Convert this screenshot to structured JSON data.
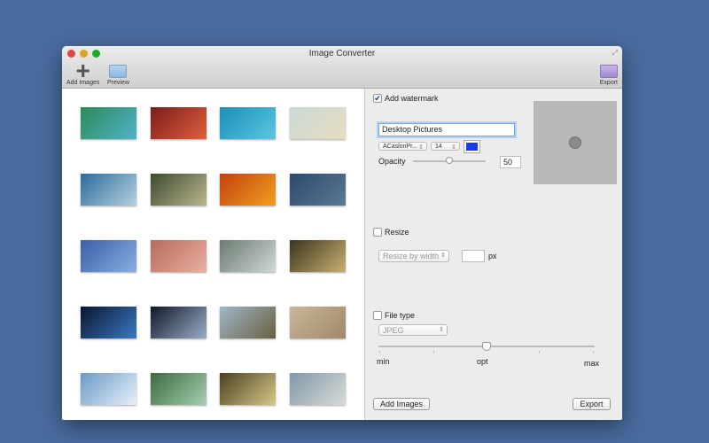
{
  "window": {
    "title": "Image Converter"
  },
  "toolbar": {
    "add_images": "Add Images",
    "preview": "Preview",
    "export": "Export"
  },
  "thumbnails": [
    [
      "#2c8a5a",
      "#4fb3c9"
    ],
    [
      "#7a1c1c",
      "#e0603c"
    ],
    [
      "#1a8fb8",
      "#5cc7e0"
    ],
    [
      "#c9d9d6",
      "#e8dcc0"
    ],
    [
      "#2a6c9a",
      "#b7d0e0"
    ],
    [
      "#3d4a30",
      "#b9b58a"
    ],
    [
      "#c4400f",
      "#f0a020"
    ],
    [
      "#2b4a6c",
      "#5d7894"
    ],
    [
      "#3a5fa8",
      "#8aaee0"
    ],
    [
      "#b86a60",
      "#e8b0a0"
    ],
    [
      "#6a7a70",
      "#d0d8d8"
    ],
    [
      "#3b3520",
      "#c8b070"
    ],
    [
      "#0a1530",
      "#3a7ac0"
    ],
    [
      "#101828",
      "#9aaec8"
    ],
    [
      "#a0b8c8",
      "#6a6040"
    ],
    [
      "#c8b898",
      "#a08868"
    ],
    [
      "#6a9ac8",
      "#e8f0f8"
    ],
    [
      "#3a6a40",
      "#a8d0b0"
    ],
    [
      "#4a4020",
      "#d8c888"
    ],
    [
      "#8098a8",
      "#d8dcd8"
    ]
  ],
  "watermark": {
    "label": "Add watermark",
    "checked": true,
    "text": "Desktop Pictures",
    "font": "ACaslonPr...",
    "size": "14",
    "color": "#1a3cf0",
    "opacity_label": "Opacity",
    "opacity": "50",
    "opacity_value": 50
  },
  "resize": {
    "label": "Resize",
    "checked": false,
    "mode": "Resize by width",
    "value": "",
    "unit": "px"
  },
  "file_type": {
    "label": "File type",
    "checked": false,
    "format": "JPEG",
    "quality_labels": [
      "min",
      "opt",
      "max"
    ],
    "quality_value": 0.5
  },
  "buttons": {
    "add_images": "Add Images",
    "export": "Export"
  }
}
